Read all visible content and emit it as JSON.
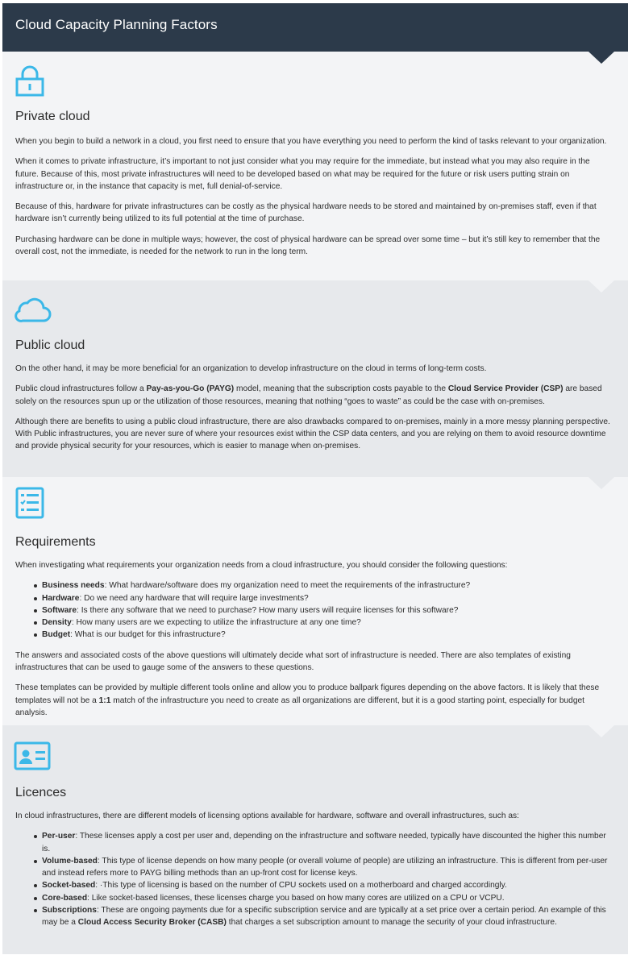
{
  "page_title": "Cloud Capacity Planning Factors",
  "colors": {
    "header_bg": "#2c3a4a",
    "accent_icon": "#3bb8e8",
    "section_light": "#f3f4f6",
    "section_dark": "#e7e9ec"
  },
  "sections": [
    {
      "icon": "lock-icon",
      "title": "Private cloud",
      "paragraphs": [
        "When you begin to build a network in a cloud, you first need to ensure that you have everything you need to perform the kind of tasks relevant to your organization.",
        "When it comes to private infrastructure, it’s important to not just consider what you may require for the immediate, but instead what you may also require in the future. Because of this, most private infrastructures will need to be developed based on what may be required for the future or risk users putting strain on infrastructure or, in the instance that capacity is met, full denial-of-service.",
        "Because of this, hardware for private infrastructures can be costly as the physical hardware needs to be stored and maintained by on-premises staff, even if that hardware isn’t currently being utilized to its full potential at the time of purchase.",
        "Purchasing hardware can be done in multiple ways; however, the cost of physical hardware can be spread over some time – but it’s still key to remember that the overall cost, not the immediate, is needed for the network to run in the long term."
      ]
    },
    {
      "icon": "cloud-icon",
      "title": "Public cloud",
      "p1": "On the other hand, it may be more beneficial for an organization to develop infrastructure on the cloud in terms of long-term costs.",
      "p2_a": "Public cloud infrastructures follow a ",
      "p2_b": "Pay-as-you-Go (PAYG)",
      "p2_c": " model, meaning that the subscription costs payable to the ",
      "p2_d": "Cloud Service Provider (CSP)",
      "p2_e": " are based solely on the resources spun up or the utilization of those resources, meaning that nothing “goes to waste” as could be the case with on-premises.",
      "p3": "Although there are benefits to using a public cloud infrastructure, there are also drawbacks compared to on-premises, mainly in a more messy planning perspective. With Public infrastructures, you are never sure of where your resources exist within the CSP data centers, and you are relying on them to avoid resource downtime and provide physical security for your resources, which is easier to manage when on-premises."
    },
    {
      "icon": "checklist-icon",
      "title": "Requirements",
      "intro": "When investigating what requirements your organization needs from a cloud infrastructure, you should consider the following questions:",
      "items": [
        {
          "term": "Business needs",
          "text": ": What hardware/software does my organization need to meet the requirements of the infrastructure?"
        },
        {
          "term": "Hardware",
          "text": ": Do we need any hardware that will require large investments?"
        },
        {
          "term": "Software",
          "text": ": Is there any software that we need to purchase? How many users will require licenses for this software?"
        },
        {
          "term": "Density",
          "text": ": How many users are we expecting to utilize the infrastructure at any one time?"
        },
        {
          "term": "Budget",
          "text": ": What is our budget for this infrastructure?"
        }
      ],
      "p_after": "The answers and associated costs of the above questions will ultimately decide what sort of infrastructure is needed. There are also templates of existing infrastructures that can be used to gauge some of the answers to these questions.",
      "p_last_a": "These templates can be provided by multiple different tools online and allow you to produce ballpark figures depending on the above factors. It is likely that these templates will not be a ",
      "p_last_b": "1:1",
      "p_last_c": " match of the infrastructure you need to create as all organizations are different, but it is a good starting point, especially for budget analysis."
    },
    {
      "icon": "id-card-icon",
      "title": "Licences",
      "intro": "In cloud infrastructures, there are different models of licensing options available for hardware, software and overall infrastructures, such as:",
      "items": [
        {
          "term": "Per-user",
          "text": ": These licenses apply a cost per user and, depending on the infrastructure and software needed, typically have discounted the higher this number is."
        },
        {
          "term": "Volume-based",
          "text": ": This type of license depends on how many people (or overall volume of people) are utilizing an infrastructure. This is different from per-user and instead refers more to PAYG billing methods than an up-front cost for license keys."
        },
        {
          "term": "Socket-based",
          "text": ": ·This type of licensing is based on the number of CPU sockets used on a motherboard and charged accordingly."
        },
        {
          "term": "Core-based",
          "text": ": Like socket-based licenses, these licenses charge you based on how many cores are utilized on a CPU or VCPU."
        }
      ],
      "last_term": "Subscriptions",
      "last_a": ": These are ongoing payments due for a specific subscription service and are typically at a set price over a certain period. An example of this may be a ",
      "last_b": "Cloud Access Security Broker (CASB)",
      "last_c": " that charges a set subscription amount to manage the security of your cloud infrastructure."
    }
  ]
}
